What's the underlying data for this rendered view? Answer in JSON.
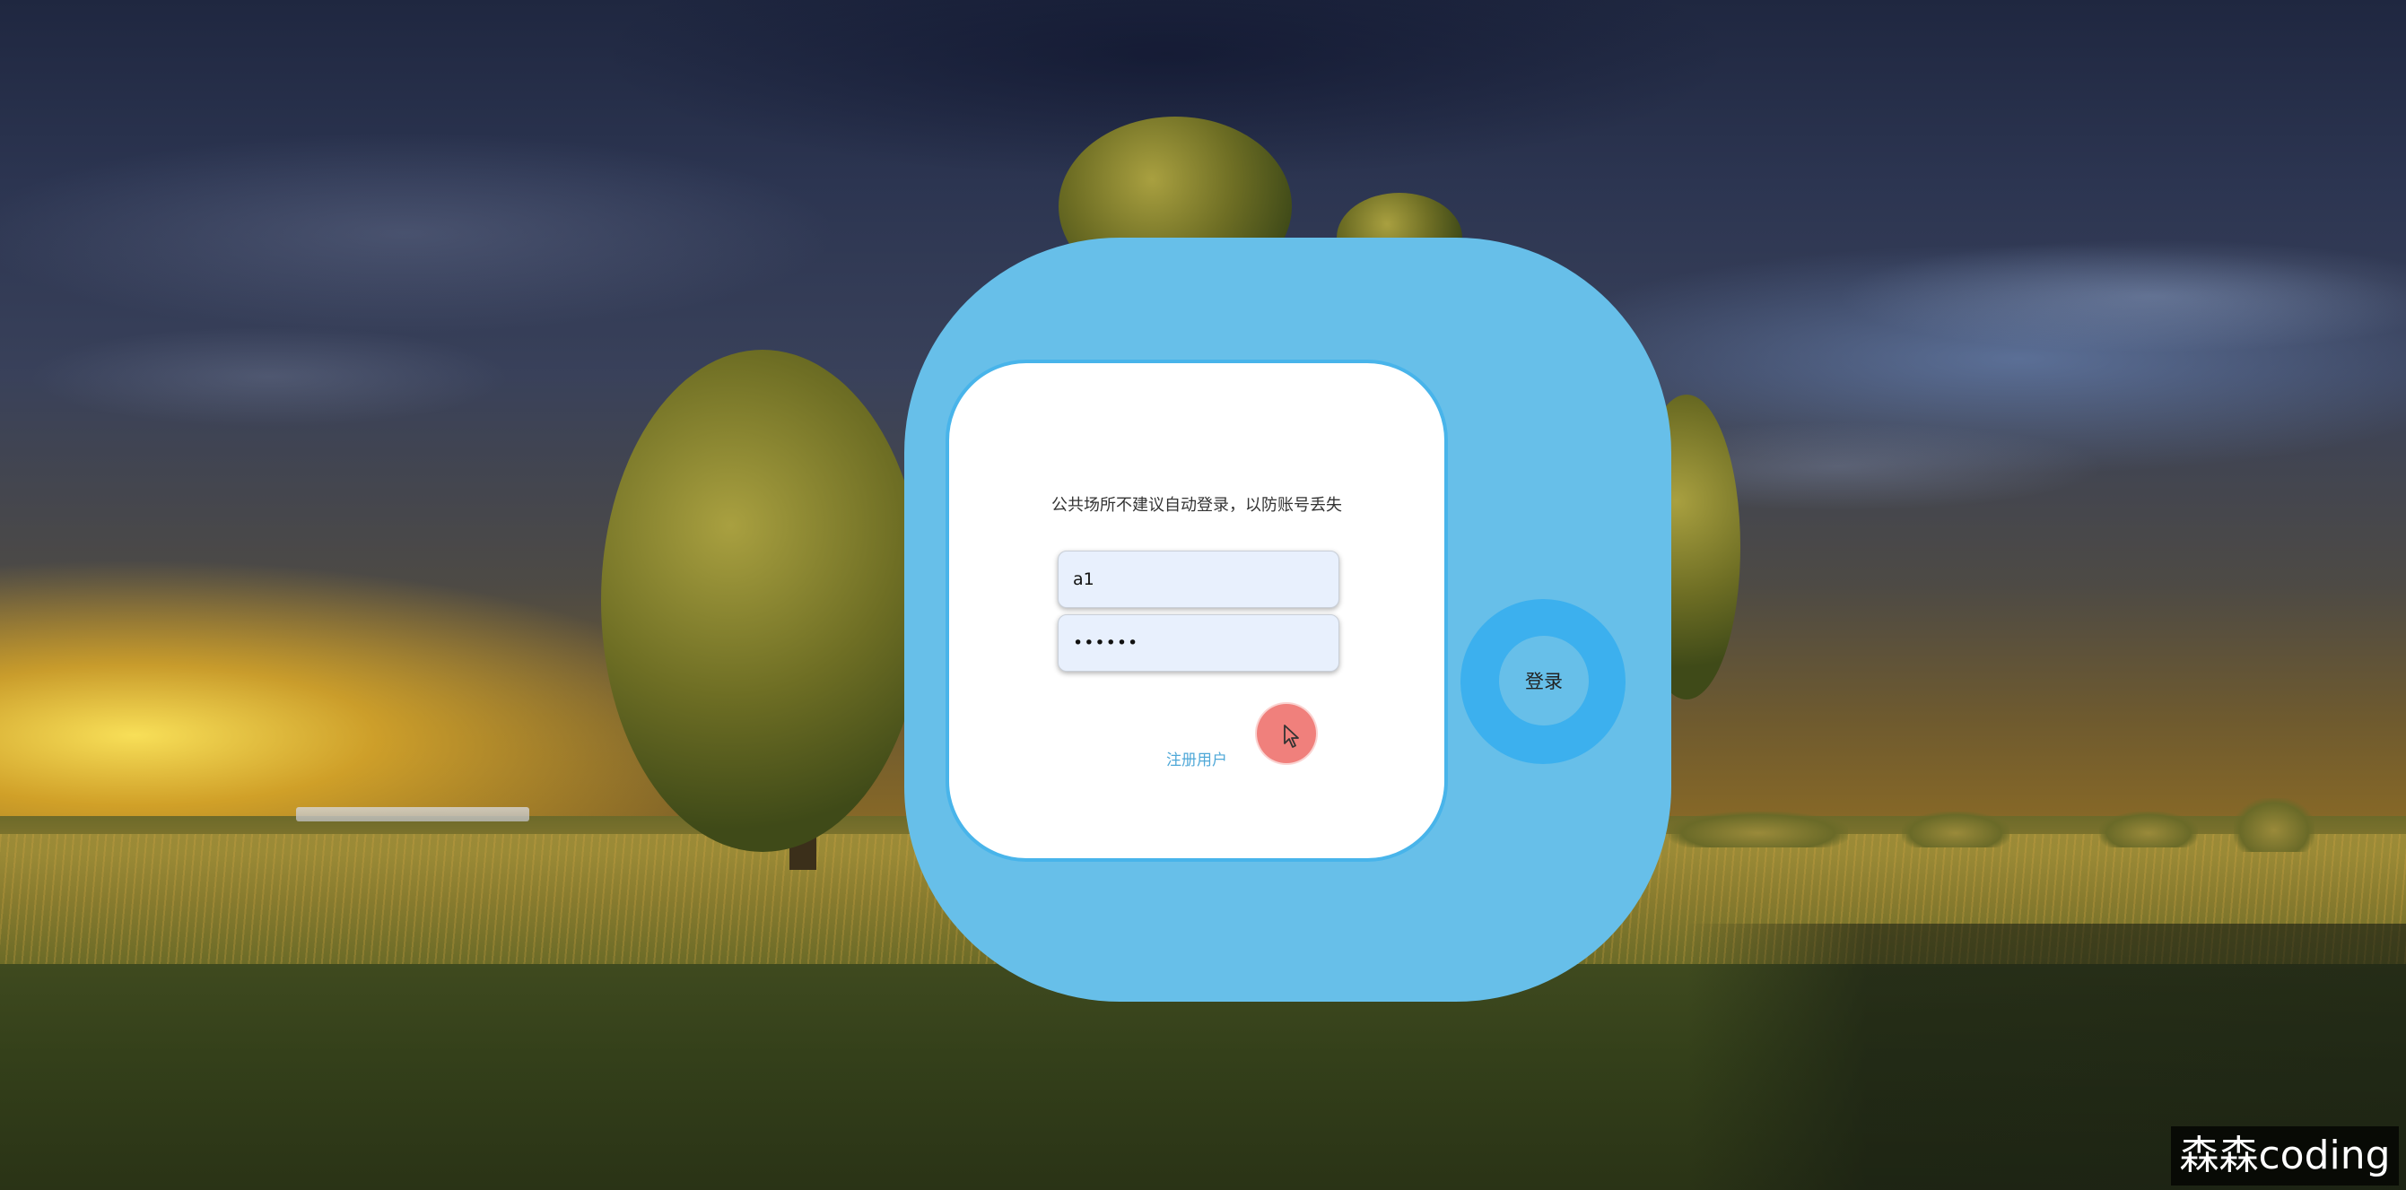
{
  "login": {
    "notice": "公共场所不建议自动登录，以防账号丢失",
    "username_value": "a1",
    "password_value": "••••••",
    "register_label": "注册用户",
    "login_label": "登录"
  },
  "watermark": {
    "text": "森森coding"
  },
  "colors": {
    "blob": "#67bfe9",
    "ring": "#3cb0ee",
    "card_border": "#48b4ea",
    "input_bg": "#e8f0fd",
    "link": "#4fa8d8",
    "click_indicator": "#f0807c"
  },
  "icons": {
    "cursor": "cursor-arrow-icon"
  }
}
